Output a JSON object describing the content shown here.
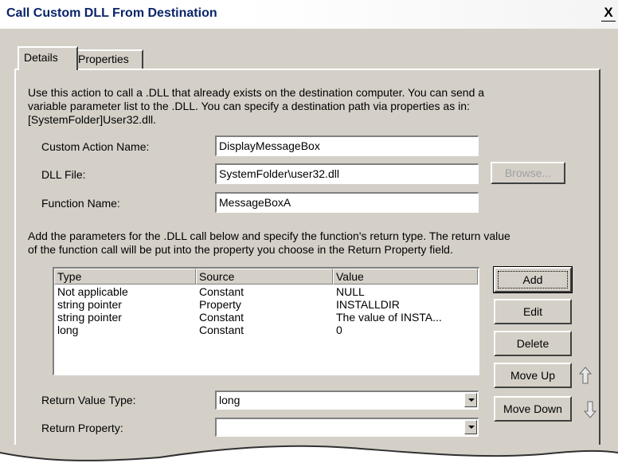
{
  "window": {
    "title": "Call Custom DLL From Destination",
    "close_glyph": "X"
  },
  "tabs": [
    {
      "label": "Details"
    },
    {
      "label": "Properties"
    }
  ],
  "details": {
    "intro_lines": [
      "Use this action to call a .DLL that already exists on the destination computer. You can send a",
      "variable parameter list to the .DLL. You can specify a destination path via properties as in:",
      "[SystemFolder]User32.dll."
    ],
    "fields": {
      "custom_action_name": {
        "label": "Custom Action Name:",
        "value": "DisplayMessageBox"
      },
      "dll_file": {
        "label": "DLL File:",
        "value": "SystemFolder\\user32.dll"
      },
      "function_name": {
        "label": "Function Name:",
        "value": "MessageBoxA"
      }
    },
    "browse_label": "Browse...",
    "params_lines": [
      "Add the parameters for the .DLL call below and specify the function's return type. The return value",
      "of the function call will be put into the property you choose in the Return Property field."
    ],
    "table": {
      "columns": [
        "Type",
        "Source",
        "Value"
      ],
      "rows": [
        [
          "Not applicable",
          "Constant",
          "NULL"
        ],
        [
          "string pointer",
          "Property",
          "INSTALLDIR"
        ],
        [
          "string pointer",
          "Constant",
          "The value of INSTA..."
        ],
        [
          "long",
          "Constant",
          "0"
        ]
      ]
    },
    "buttons": {
      "add": "Add",
      "edit": "Edit",
      "delete": "Delete",
      "move_up": "Move Up",
      "move_down": "Move Down"
    },
    "return_value_type": {
      "label": "Return Value Type:",
      "value": "long"
    },
    "return_property": {
      "label": "Return Property:",
      "value": ""
    }
  },
  "icons": {
    "move_up": "up-arrow-icon",
    "move_down": "down-arrow-icon"
  },
  "colors": {
    "dialog_bg": "#d4d0c8",
    "title_text": "#0a246a"
  }
}
